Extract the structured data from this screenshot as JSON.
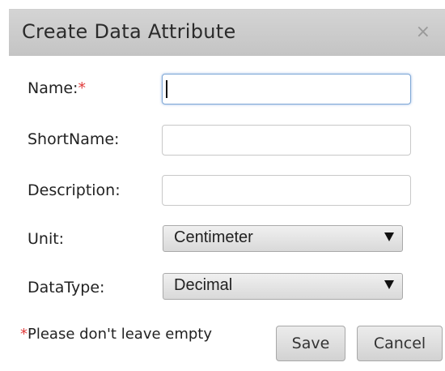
{
  "dialog": {
    "title": "Create Data Attribute",
    "close_glyph": "×"
  },
  "form": {
    "name": {
      "label": "Name:",
      "required_marker": "*",
      "value": ""
    },
    "shortname": {
      "label": "ShortName:",
      "value": ""
    },
    "description": {
      "label": "Description:",
      "value": ""
    },
    "unit": {
      "label": "Unit:",
      "selected": "Centimeter"
    },
    "datatype": {
      "label": "DataType:",
      "selected": "Decimal"
    }
  },
  "footer": {
    "required_marker": "*",
    "required_note": "Please don't leave empty",
    "save_label": "Save",
    "cancel_label": "Cancel"
  },
  "colors": {
    "required": "#e03a3a",
    "titlebar": "#cacaca",
    "focus_border": "#7ea7d6"
  },
  "icons": {
    "close": "close-icon",
    "dropdown": "chevron-down-icon"
  }
}
